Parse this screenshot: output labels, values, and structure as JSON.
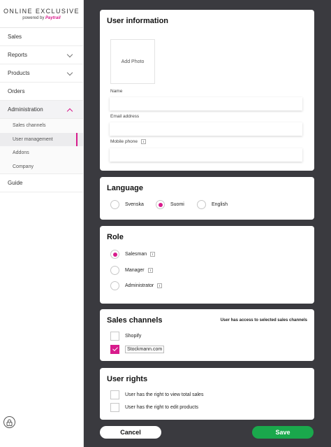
{
  "brand": {
    "title": "ONLINE EXCLUSIVE",
    "powered_by": "powered by",
    "provider": "Paytrail"
  },
  "sidebar": {
    "items": [
      {
        "label": "Sales"
      },
      {
        "label": "Reports"
      },
      {
        "label": "Products"
      },
      {
        "label": "Orders"
      },
      {
        "label": "Administration"
      },
      {
        "label": "Guide"
      }
    ],
    "admin_sub": [
      {
        "label": "Sales channels"
      },
      {
        "label": "User management"
      },
      {
        "label": "Addons"
      },
      {
        "label": "Company"
      }
    ]
  },
  "user_info": {
    "title": "User information",
    "add_photo": "Add Photo",
    "name_label": "Name",
    "name_value": "",
    "email_label": "Email address",
    "email_value": "",
    "phone_label": "Mobile phone",
    "phone_value": ""
  },
  "language": {
    "title": "Language",
    "options": [
      "Svenska",
      "Suomi",
      "English"
    ],
    "selected": "Suomi"
  },
  "role": {
    "title": "Role",
    "options": [
      "Salesman",
      "Manager",
      "Administrator"
    ],
    "selected": "Salesman"
  },
  "sales_channels": {
    "title": "Sales channels",
    "hint": "User has access to selected sales channels",
    "items": [
      {
        "label": "Shopify",
        "checked": false
      },
      {
        "label": "Stockmann.com",
        "checked": true
      }
    ]
  },
  "user_rights": {
    "title": "User rights",
    "items": [
      {
        "label": "User has the right to view total sales",
        "checked": false
      },
      {
        "label": "User has the right to edit products",
        "checked": false
      }
    ]
  },
  "actions": {
    "cancel": "Cancel",
    "save": "Save"
  },
  "colors": {
    "accent": "#d81b8c",
    "save": "#1aa84c",
    "background": "#3a3a3f"
  }
}
